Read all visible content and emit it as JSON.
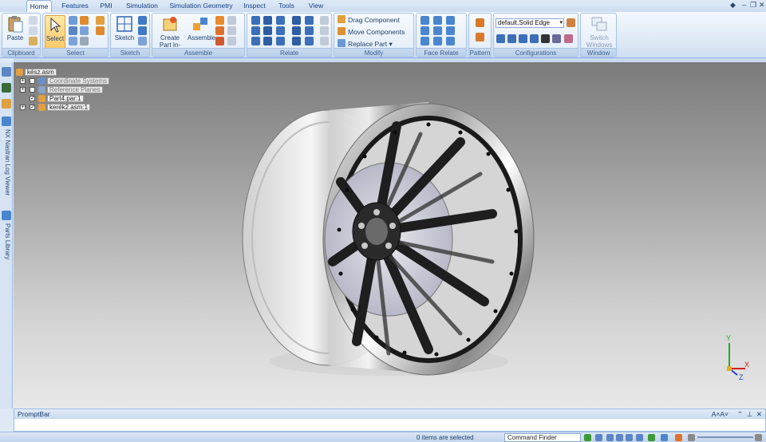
{
  "tabs": [
    {
      "label": "Home",
      "active": true
    },
    {
      "label": "Features"
    },
    {
      "label": "PMI"
    },
    {
      "label": "Simulation"
    },
    {
      "label": "Simulation Geometry"
    },
    {
      "label": "Inspect"
    },
    {
      "label": "Tools"
    },
    {
      "label": "View"
    }
  ],
  "ribbon": {
    "clipboard": {
      "label": "Clipboard",
      "paste": "Paste"
    },
    "select": {
      "label": "Select",
      "select_btn": "Select"
    },
    "sketch": {
      "label": "Sketch",
      "sketch_btn": "Sketch"
    },
    "assemble": {
      "label": "Assemble",
      "create_part": "Create Part In-Place",
      "assemble_btn": "Assemble"
    },
    "relate": {
      "label": "Relate"
    },
    "modify": {
      "label": "Modify",
      "drag": "Drag Component",
      "move": "Move Components",
      "replace": "Replace Part"
    },
    "face_relate": {
      "label": "Face Relate"
    },
    "pattern": {
      "label": "Pattern"
    },
    "configurations": {
      "label": "Configurations",
      "value": "default,Solid Edge"
    },
    "window": {
      "label": "Window",
      "switch": "Switch Windows"
    }
  },
  "left_panels": {
    "nastran": "NX Nastran Log Viewer",
    "parts": "Parts Library"
  },
  "tree": {
    "root": "kész.asm",
    "items": [
      {
        "label": "Coordinate Systems",
        "checked": false,
        "dim": true
      },
      {
        "label": "Reference Planes",
        "checked": false,
        "dim": true
      },
      {
        "label": "Part4.par:1",
        "checked": true,
        "dim": false
      },
      {
        "label": "kerék2.asm:1",
        "checked": true,
        "dim": false
      }
    ]
  },
  "axes": {
    "x": "X",
    "y": "Y",
    "z": "Z"
  },
  "promptbar": {
    "title": "PromptBar"
  },
  "status": {
    "selected": "0 items are selected",
    "command_finder": "Command Finder"
  },
  "colors": {
    "accent": "#15428b",
    "ribbon_border": "#8db2e3",
    "viewport_top": "#7b7b7b",
    "viewport_bottom": "#e8e8e8"
  }
}
